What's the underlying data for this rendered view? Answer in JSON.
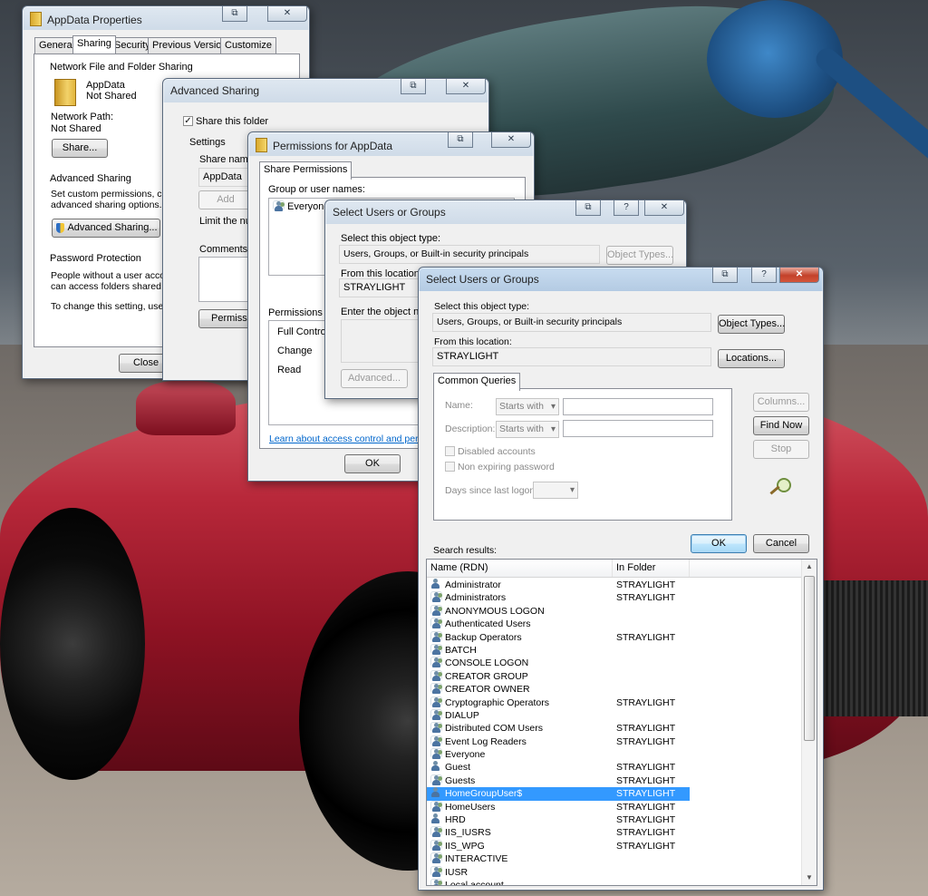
{
  "appdata_props": {
    "title": "AppData Properties",
    "tabs": [
      "General",
      "Sharing",
      "Security",
      "Previous Versions",
      "Customize"
    ],
    "network_section": "Network File and Folder Sharing",
    "folder_name": "AppData",
    "folder_status": "Not Shared",
    "network_path_label": "Network Path:",
    "network_path_value": "Not Shared",
    "share_button": "Share...",
    "advanced_section": "Advanced Sharing",
    "advanced_desc_1": "Set custom permissions, create",
    "advanced_desc_2": "advanced sharing options.",
    "advanced_button": "Advanced Sharing...",
    "password_section": "Password Protection",
    "password_desc_1": "People without a user account",
    "password_desc_2": "can access folders shared with",
    "password_desc_3": "To change this setting, use the",
    "close_button": "Close"
  },
  "advanced_sharing": {
    "title": "Advanced Sharing",
    "share_checkbox": "Share this folder",
    "settings_label": "Settings",
    "share_name_label": "Share name",
    "share_name_value": "AppData",
    "add_button": "Add",
    "limit_label": "Limit the nu",
    "comments_label": "Comments:",
    "permissions_button": "Permissio"
  },
  "permissions": {
    "title": "Permissions for AppData",
    "tab": "Share Permissions",
    "group_label": "Group or user names:",
    "group_item": "Everyone",
    "permissions_for_label": "Permissions for",
    "perm_items": [
      "Full Control",
      "Change",
      "Read"
    ],
    "learn_link": "Learn about access control and permissio",
    "ok_button": "OK"
  },
  "select_back": {
    "title": "Select Users or Groups",
    "object_type_label": "Select this object type:",
    "object_type_value": "Users, Groups, or Built-in security principals",
    "object_types_button": "Object Types...",
    "location_label": "From this location:",
    "location_value": "STRAYLIGHT",
    "enter_label": "Enter the object name",
    "advanced_button": "Advanced..."
  },
  "select_front": {
    "title": "Select Users or Groups",
    "object_type_label": "Select this object type:",
    "object_type_value": "Users, Groups, or Built-in security principals",
    "object_types_button": "Object Types...",
    "location_label": "From this location:",
    "location_value": "STRAYLIGHT",
    "locations_button": "Locations...",
    "common_tab": "Common Queries",
    "name_label": "Name:",
    "name_mode": "Starts with",
    "description_label": "Description:",
    "description_mode": "Starts with",
    "disabled_accounts": "Disabled accounts",
    "non_expiring": "Non expiring password",
    "days_label": "Days since last logon:",
    "columns_button": "Columns...",
    "find_now_button": "Find Now",
    "stop_button": "Stop",
    "ok_button": "OK",
    "cancel_button": "Cancel",
    "search_results_label": "Search results:",
    "col_name": "Name (RDN)",
    "col_folder": "In Folder",
    "selected_row": "HomeGroupUser$",
    "results": [
      {
        "name": "Administrator",
        "folder": "STRAYLIGHT",
        "type": "user"
      },
      {
        "name": "Administrators",
        "folder": "STRAYLIGHT",
        "type": "group"
      },
      {
        "name": "ANONYMOUS LOGON",
        "folder": "",
        "type": "group"
      },
      {
        "name": "Authenticated Users",
        "folder": "",
        "type": "group"
      },
      {
        "name": "Backup Operators",
        "folder": "STRAYLIGHT",
        "type": "group"
      },
      {
        "name": "BATCH",
        "folder": "",
        "type": "group"
      },
      {
        "name": "CONSOLE LOGON",
        "folder": "",
        "type": "group"
      },
      {
        "name": "CREATOR GROUP",
        "folder": "",
        "type": "group"
      },
      {
        "name": "CREATOR OWNER",
        "folder": "",
        "type": "group"
      },
      {
        "name": "Cryptographic Operators",
        "folder": "STRAYLIGHT",
        "type": "group"
      },
      {
        "name": "DIALUP",
        "folder": "",
        "type": "group"
      },
      {
        "name": "Distributed COM Users",
        "folder": "STRAYLIGHT",
        "type": "group"
      },
      {
        "name": "Event Log Readers",
        "folder": "STRAYLIGHT",
        "type": "group"
      },
      {
        "name": "Everyone",
        "folder": "",
        "type": "group"
      },
      {
        "name": "Guest",
        "folder": "STRAYLIGHT",
        "type": "user"
      },
      {
        "name": "Guests",
        "folder": "STRAYLIGHT",
        "type": "group"
      },
      {
        "name": "HomeGroupUser$",
        "folder": "STRAYLIGHT",
        "type": "user"
      },
      {
        "name": "HomeUsers",
        "folder": "STRAYLIGHT",
        "type": "group"
      },
      {
        "name": "HRD",
        "folder": "STRAYLIGHT",
        "type": "user"
      },
      {
        "name": "IIS_IUSRS",
        "folder": "STRAYLIGHT",
        "type": "group"
      },
      {
        "name": "IIS_WPG",
        "folder": "STRAYLIGHT",
        "type": "group"
      },
      {
        "name": "INTERACTIVE",
        "folder": "",
        "type": "group"
      },
      {
        "name": "IUSR",
        "folder": "",
        "type": "group"
      },
      {
        "name": "Local account",
        "folder": "",
        "type": "group"
      }
    ]
  },
  "colors": {
    "selection": "#3399ff",
    "close_red": "#c3412a",
    "titlebar_active": "#b4cbe3"
  }
}
